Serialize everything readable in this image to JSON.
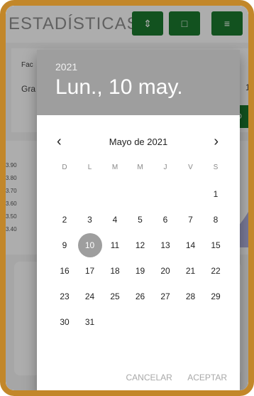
{
  "background": {
    "app_title": "ESTADÍSTICAS",
    "toolbar_icons": [
      "sort-icon",
      "document-icon",
      "filter-icon"
    ],
    "left_labels": [
      "Fac",
      "Gra"
    ],
    "right_digit": "1",
    "green_button_label": "D",
    "y_ticks": [
      "3.90",
      "3.80",
      "3.70",
      "3.60",
      "3.50",
      "3.40"
    ]
  },
  "dialog": {
    "year": "2021",
    "date": "Lun., 10 may.",
    "month_label": "Mayo de 2021",
    "weekdays": [
      "D",
      "L",
      "M",
      "M",
      "J",
      "V",
      "S"
    ],
    "days": [
      "1",
      "2",
      "3",
      "4",
      "5",
      "6",
      "7",
      "8",
      "9",
      "10",
      "11",
      "12",
      "13",
      "14",
      "15",
      "16",
      "17",
      "18",
      "19",
      "20",
      "21",
      "22",
      "23",
      "24",
      "25",
      "26",
      "27",
      "28",
      "29",
      "30",
      "31"
    ],
    "first_weekday_index": 6,
    "selected_day": "10",
    "cancel": "CANCELAR",
    "accept": "ACEPTAR"
  },
  "colors": {
    "frame": "#c2872a",
    "accent_green": "#1b7a2f",
    "header_gray": "#9e9e9e"
  }
}
